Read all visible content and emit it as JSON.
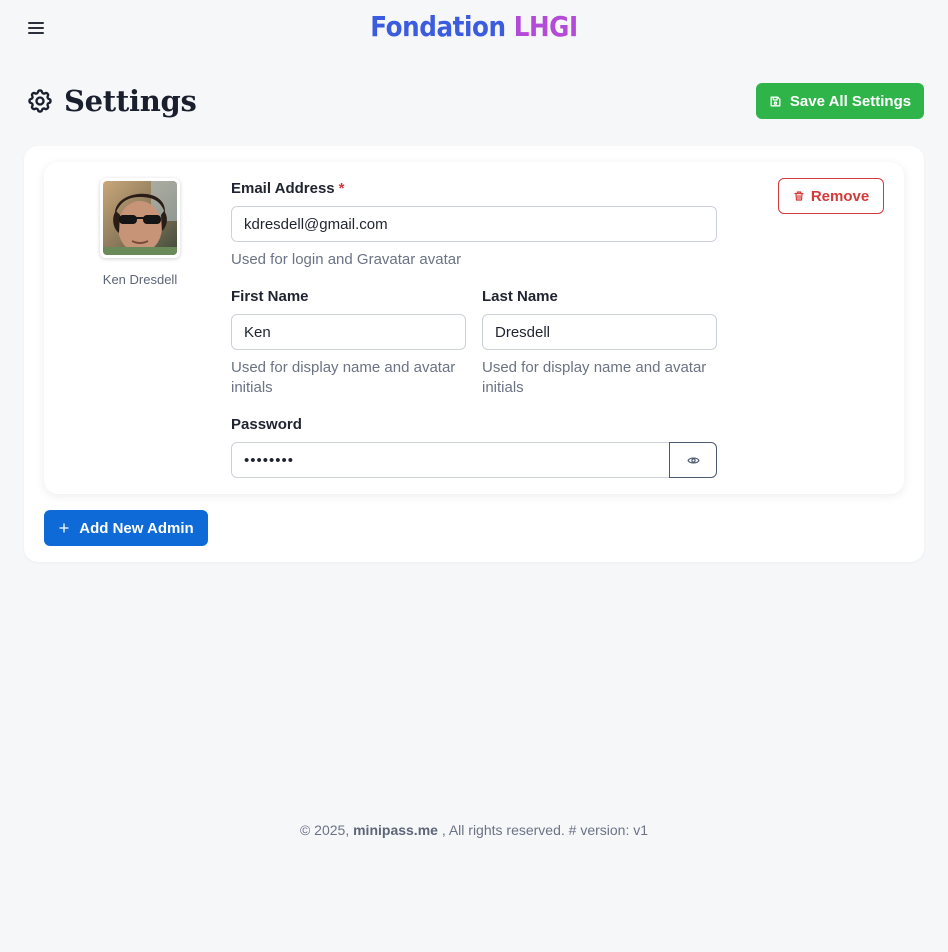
{
  "header": {
    "brand_part1": "Fondation",
    "brand_part2": "LHGI",
    "menu_icon": "hamburger-menu-icon"
  },
  "page": {
    "title": "Settings",
    "title_icon": "gear-icon",
    "save_label": "Save All Settings",
    "save_icon": "floppy-disk-icon"
  },
  "admins": [
    {
      "display_name": "Ken Dresdell",
      "email_label": "Email Address",
      "email_required_marker": "*",
      "email": "kdresdell@gmail.com",
      "email_hint": "Used for login and Gravatar avatar",
      "first_name_label": "First Name",
      "first_name": "Ken",
      "first_name_hint": "Used for display name and avatar initials",
      "last_name_label": "Last Name",
      "last_name": "Dresdell",
      "last_name_hint": "Used for display name and avatar initials",
      "password_label": "Password",
      "password": "••••••••",
      "password_toggle_icon": "eye-icon",
      "remove_label": "Remove",
      "remove_icon": "trash-icon"
    }
  ],
  "actions": {
    "add_admin_label": "Add New Admin",
    "add_admin_icon": "plus-icon"
  },
  "footer": {
    "prefix": "© 2025,",
    "site": "minipass.me",
    "suffix": ", All rights reserved. # version: v1"
  },
  "colors": {
    "save_button": "#2fb44a",
    "add_button": "#0e6ad6",
    "remove_button": "#d43a3a",
    "brand_blue": "#3c5ce0",
    "brand_purple": "#b44ad8"
  }
}
